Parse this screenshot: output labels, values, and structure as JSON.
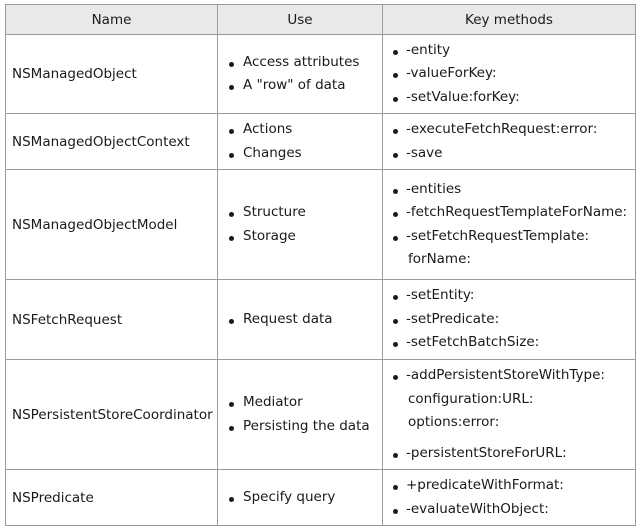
{
  "headers": [
    "Name",
    "Use",
    "Key methods"
  ],
  "rows": [
    {
      "name": "NSManagedObject",
      "use": [
        "Access attributes",
        "A \"row\" of data"
      ],
      "methods": [
        "-entity",
        "-valueForKey:",
        "-setValue:forKey:"
      ]
    },
    {
      "name": "NSManagedObjectContext",
      "use": [
        "Actions",
        "Changes"
      ],
      "methods": [
        "-executeFetchRequest:error:",
        "-save"
      ]
    },
    {
      "name": "NSManagedObjectModel",
      "use": [
        "Structure",
        "Storage"
      ],
      "methods": [
        "-entities",
        "-fetchRequestTemplateForName:",
        "-setFetchRequestTemplate:"
      ],
      "methods_continuation": [
        "forName:"
      ]
    },
    {
      "name": "NSFetchRequest",
      "use": [
        "Request data"
      ],
      "methods": [
        "-setEntity:",
        "-setPredicate:",
        "-setFetchBatchSize:"
      ]
    },
    {
      "name": "NSPersistentStoreCoordinator",
      "use": [
        "Mediator",
        "Persisting the data"
      ],
      "methods": [
        "-addPersistentStoreWithType:"
      ],
      "methods_continuation": [
        "configuration:URL:",
        "options:error:"
      ],
      "methods_after": [
        "-persistentStoreForURL:"
      ]
    },
    {
      "name": "NSPredicate",
      "use": [
        "Specify query"
      ],
      "methods": [
        "+predicateWithFormat:",
        "-evaluateWithObject:"
      ]
    }
  ]
}
